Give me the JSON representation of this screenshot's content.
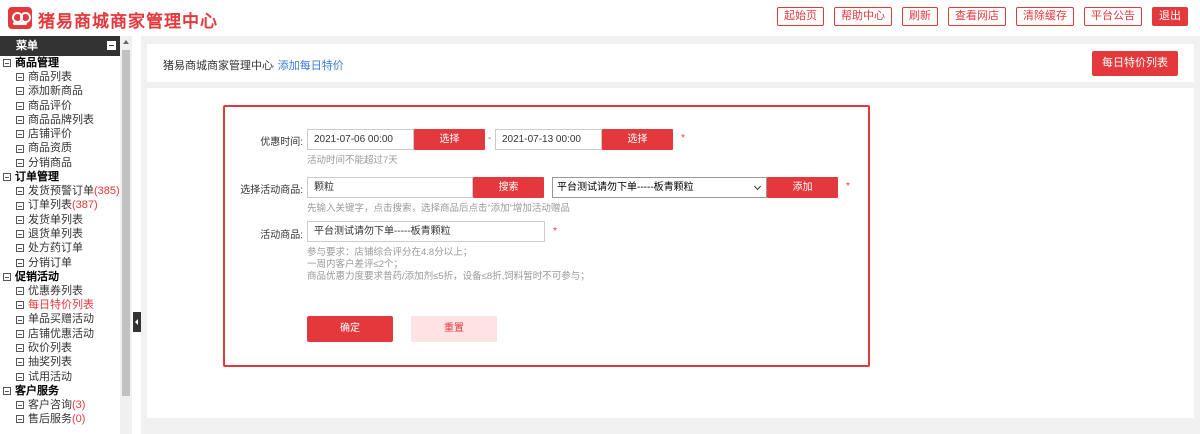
{
  "header": {
    "brand": "猪易商城商家管理中心",
    "nav": [
      {
        "label": "起始页"
      },
      {
        "label": "帮助中心"
      },
      {
        "label": "刷新"
      },
      {
        "label": "查看网店"
      },
      {
        "label": "清除缓存"
      },
      {
        "label": "平台公告"
      },
      {
        "label": "退出"
      }
    ]
  },
  "sidebar": {
    "title": "菜单",
    "groups": [
      {
        "title": "商品管理",
        "items": [
          "商品列表",
          "添加新商品",
          "商品评价",
          "商品品牌列表",
          "店铺评价",
          "商品资质",
          "分销商品"
        ]
      },
      {
        "title": "订单管理",
        "items": [
          "发货预警订单",
          "订单列表",
          "发货单列表",
          "退货单列表",
          "处方药订单",
          "分销订单"
        ],
        "counts": {
          "0": "(385)",
          "1": "(387)"
        }
      },
      {
        "title": "促销活动",
        "items": [
          "优惠券列表",
          "每日特价列表",
          "单品买赠活动",
          "店铺优惠活动",
          "砍价列表",
          "抽奖列表",
          "试用活动"
        ]
      },
      {
        "title": "客户服务",
        "items": [
          "客户咨询",
          "售后服务"
        ],
        "counts": {
          "0": "(3)",
          "1": "(0)"
        }
      }
    ]
  },
  "breadcrumb": {
    "root": "猪易商城商家管理中心",
    "current": "- 添加每日特价"
  },
  "list_button": "每日特价列表",
  "form": {
    "time_label": "优惠时间:",
    "start_date": "2021-07-06 00:00",
    "end_date": "2021-07-13 00:00",
    "pick_label": "选择",
    "range_sep": "-",
    "time_hint": "活动时间不能超过7天",
    "product_label": "选择活动商品:",
    "keyword": "颗粒",
    "search_label": "搜索",
    "selected_option": "平台测试请勿下单-----板青颗粒",
    "add_label": "添加",
    "product_hint": "先输入关键字，点击搜索，选择商品后点击“添加”增加活动赠品",
    "activity_label": "活动商品:",
    "activity_product": "平台测试请勿下单-----板青颗粒",
    "requirements": [
      "参与要求：店铺综合评分在4.8分以上；",
      "一周内客户差评≤2个；",
      "商品优惠力度要求普药/添加剂≤5折，设备≤8折,饲料暂时不可参与；"
    ],
    "required_mark": "*",
    "confirm_label": "确定",
    "reset_label": "重置"
  }
}
